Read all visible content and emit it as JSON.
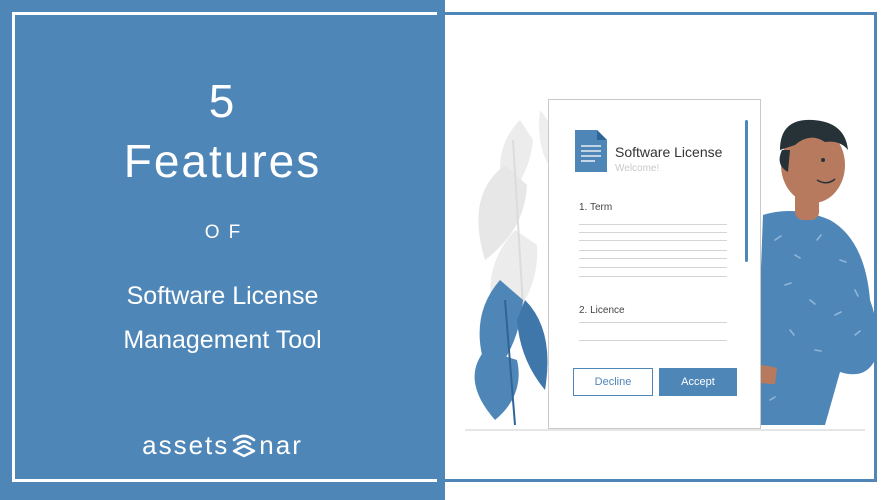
{
  "heading": {
    "number": "5",
    "word": "Features",
    "connector": "OF",
    "subtitle_line1": "Software License",
    "subtitle_line2": "Management Tool"
  },
  "logo": {
    "left": "assets",
    "right": "nar",
    "icon": "sonar-wave-icon"
  },
  "license_card": {
    "title": "Software License",
    "subtitle": "Welcome!",
    "section1": "1. Term",
    "section2": "2. Licence",
    "decline_label": "Decline",
    "accept_label": "Accept",
    "icon": "document-icon"
  },
  "colors": {
    "brand_blue": "#4f86b8",
    "white": "#ffffff",
    "plant_grey": "#e6e6e6",
    "skin": "#b87a5e",
    "hair": "#263238"
  }
}
